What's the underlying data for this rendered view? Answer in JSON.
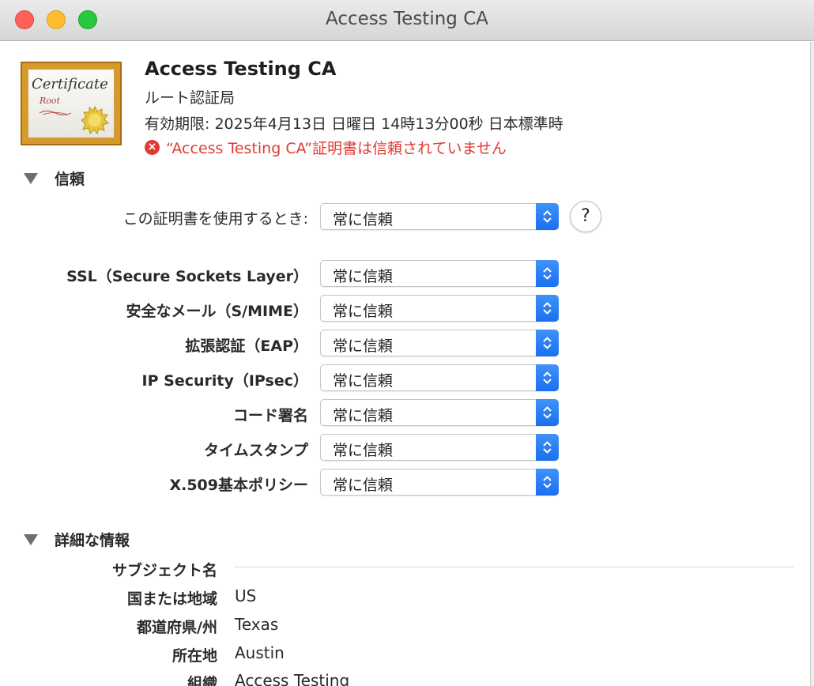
{
  "window": {
    "title": "Access Testing CA"
  },
  "certificate": {
    "icon_script": "Certificate",
    "icon_root": "Root",
    "name": "Access Testing CA",
    "type": "ルート認証局",
    "expiry": "有効期限: 2025年4月13日 日曜日 14時13分00秒 日本標準時",
    "warning": "“Access Testing CA”証明書は信頼されていません"
  },
  "trust": {
    "section_label": "信頼",
    "when_using_label": "この証明書を使用するとき:",
    "when_using_value": "常に信頼",
    "help_label": "?",
    "rows": [
      {
        "label": "SSL（Secure Sockets Layer）",
        "value": "常に信頼"
      },
      {
        "label": "安全なメール（S/MIME）",
        "value": "常に信頼"
      },
      {
        "label": "拡張認証（EAP）",
        "value": "常に信頼"
      },
      {
        "label": "IP Security（IPsec）",
        "value": "常に信頼"
      },
      {
        "label": "コード署名",
        "value": "常に信頼"
      },
      {
        "label": "タイムスタンプ",
        "value": "常に信頼"
      },
      {
        "label": "X.509基本ポリシー",
        "value": "常に信頼"
      }
    ]
  },
  "details": {
    "section_label": "詳細な情報",
    "subject_heading": "サブジェクト名",
    "fields": [
      {
        "label": "国または地域",
        "value": "US"
      },
      {
        "label": "都道府県/州",
        "value": "Texas"
      },
      {
        "label": "所在地",
        "value": "Austin"
      },
      {
        "label": "組織",
        "value": "Access Testing"
      }
    ]
  },
  "colors": {
    "accent": "#1a6ff0",
    "warning": "#e03a32"
  },
  "icons": [
    "certificate-icon",
    "error-icon",
    "disclosure-triangle-icon",
    "updown-chevron-icon",
    "help-icon"
  ]
}
